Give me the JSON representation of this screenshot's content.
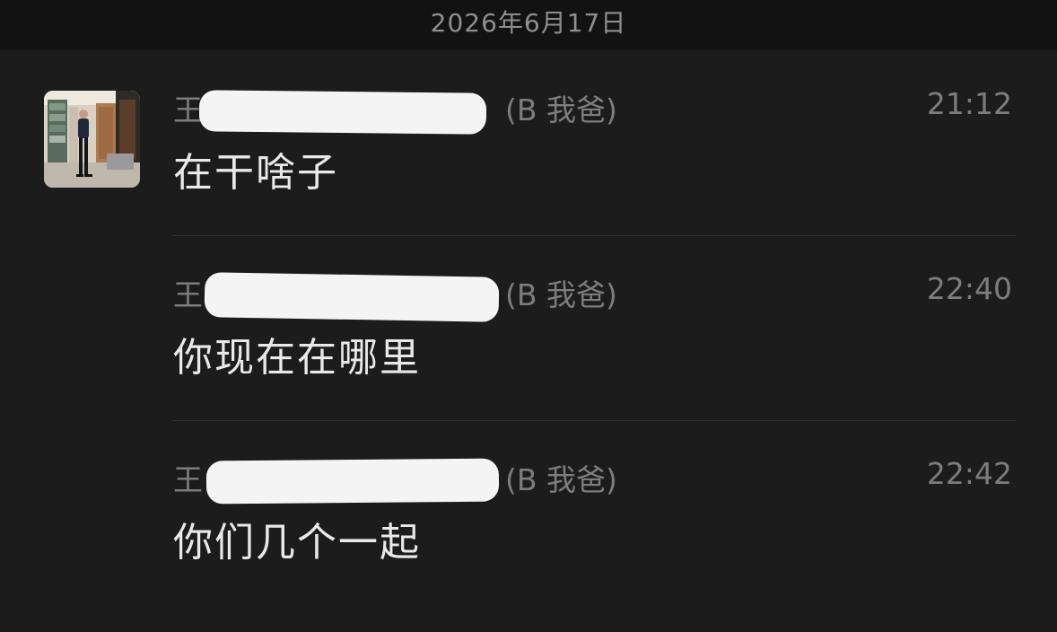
{
  "header": {
    "date": "2026年6月17日"
  },
  "messages": [
    {
      "sender_prefix": "王",
      "sender_note": "(B 我爸)",
      "time": "21:12",
      "text": "在干啥子"
    },
    {
      "sender_prefix": "王",
      "sender_note": "(B 我爸)",
      "time": "22:40",
      "text": "你现在在哪里"
    },
    {
      "sender_prefix": "王",
      "sender_note": "(B 我爸)",
      "time": "22:42",
      "text": "你们几个一起"
    }
  ],
  "icons": {
    "back": "chevron-left-icon",
    "avatar": "user-avatar"
  },
  "colors": {
    "background": "#1c1c1c",
    "header_background": "#121212",
    "meta_text": "#7d7d7d",
    "message_text": "#e9e9e9",
    "redaction": "#f4f4f4"
  }
}
